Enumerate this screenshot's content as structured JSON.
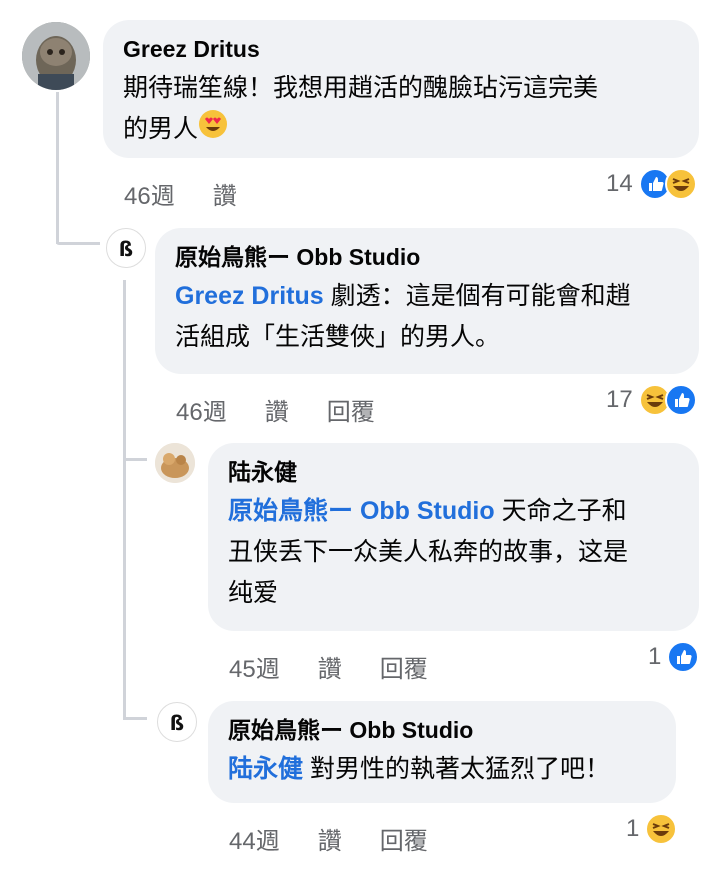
{
  "comments": [
    {
      "author": "Greez Dritus",
      "mention": "",
      "text_line1": "期待瑞笙線！我想用趙活的醜臉玷污這完美",
      "text_line2": "的男人",
      "emoji_inline": "heart-eyes",
      "time": "46週",
      "like_label": "讚",
      "reply_label": "",
      "reactions": {
        "count": "14",
        "icons": [
          "like",
          "haha"
        ]
      }
    },
    {
      "author": "原始鳥熊ー Obb Studio",
      "mention": "Greez Dritus",
      "text_line1": " 劇透：這是個有可能會和趙",
      "text_line2": "活組成「生活雙俠」的男人。",
      "time": "46週",
      "like_label": "讚",
      "reply_label": "回覆",
      "reactions": {
        "count": "17",
        "icons": [
          "haha",
          "like"
        ]
      }
    },
    {
      "author": "陆永健",
      "mention": "原始鳥熊ー Obb Studio",
      "text_line1": " 天命之子和",
      "text_line2": "丑侠丢下一众美人私奔的故事，这是",
      "text_line3": "纯爱",
      "time": "45週",
      "like_label": "讚",
      "reply_label": "回覆",
      "reactions": {
        "count": "1",
        "icons": [
          "like"
        ]
      }
    },
    {
      "author": "原始鳥熊ー Obb Studio",
      "mention": "陆永健",
      "text_line1": " 對男性的執著太猛烈了吧！",
      "time": "44週",
      "like_label": "讚",
      "reply_label": "回覆",
      "reactions": {
        "count": "1",
        "icons": [
          "haha"
        ]
      }
    }
  ],
  "colors": {
    "bubble": "#f0f2f5",
    "mention": "#216fdb",
    "meta": "#65676b",
    "like": "#1877f2",
    "haha": "#f7c23b"
  }
}
